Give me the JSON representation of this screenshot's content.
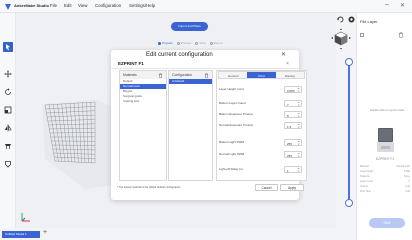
{
  "app": {
    "name": "AnkerMake Studio"
  },
  "menubar": {
    "file": "File",
    "edit": "Edit",
    "view": "View",
    "configuration": "Configuration",
    "settings": "Settings/Help"
  },
  "toolbar": {
    "import_label": "Import and Place"
  },
  "steps": [
    "Prepare",
    "Preview",
    "Slice",
    "Export"
  ],
  "bottom": {
    "file_tab": "Untitled Model 1",
    "add_tab": "+"
  },
  "right_panel": {
    "title": "File Layer",
    "hint": "Double-click to import model",
    "printer_name": "EZPRINT F1",
    "info": [
      {
        "label": "Material",
        "value": "Normal resin"
      },
      {
        "label": "Layer Height",
        "value": "0.050"
      },
      {
        "label": "Supports",
        "value": "None"
      },
      {
        "label": "Layer Count",
        "value": "0"
      },
      {
        "label": "Volume",
        "value": "0.00"
      },
      {
        "label": "Print Time",
        "value": "0:00"
      }
    ],
    "slice_label": "Slice"
  },
  "modal": {
    "title": "Edit current configuration",
    "printer": "EZPRINT F1",
    "materials_header": "Materials",
    "config_header": "Configuration",
    "materials": [
      "Default",
      "Normal resin",
      "Binghe",
      "Surgical guide",
      "Casting wax"
    ],
    "selected_material": 1,
    "configs": [
      "A Default"
    ],
    "tabs": [
      "General",
      "Print",
      "Raising"
    ],
    "active_tab": 1,
    "params": [
      {
        "label": "Layer Height (mm)",
        "value": "0.050"
      },
      {
        "label": "Bottom Layer Count",
        "value": "7"
      },
      {
        "label": "Bottom Exposure Time(s)",
        "value": "8"
      },
      {
        "label": "Normal Exposure Time(s)",
        "value": "1.5"
      },
      {
        "label": "Bottom Light PWM",
        "value": "255"
      },
      {
        "label": "Normal Light PWM",
        "value": "255"
      },
      {
        "label": "Light-off Delay (s)",
        "value": "1"
      }
    ],
    "footnote": "* The locked material is the official default configuration.",
    "cancel": "Cancel",
    "apply": "Apply"
  },
  "background": {
    "import_btn": "Create Materials profiles",
    "apply": "Apply"
  },
  "colors": {
    "accent": "#3b63d2",
    "slider": "#4e73d8"
  }
}
